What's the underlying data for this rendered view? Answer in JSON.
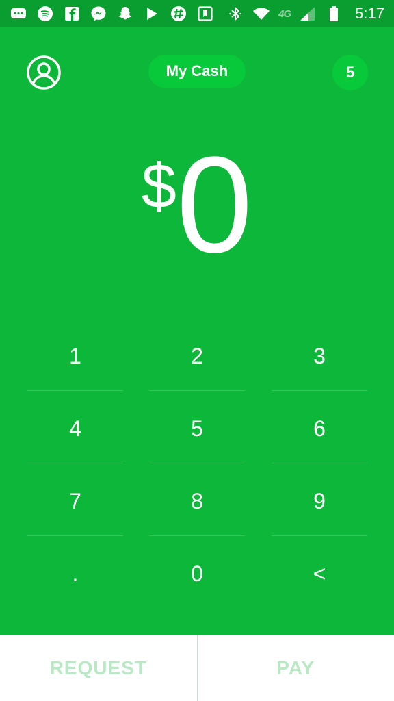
{
  "status_bar": {
    "icons_left": [
      "message-icon",
      "spotify-icon",
      "facebook-icon",
      "messenger-icon",
      "snapchat-icon",
      "play-store-icon",
      "slack-icon",
      "bookmark-icon"
    ],
    "icons_right": [
      "bluetooth-icon",
      "wifi-icon",
      "signal-icon",
      "battery-icon"
    ],
    "network": "4G",
    "time": "5:17"
  },
  "header": {
    "profile_icon": "person-circle-icon",
    "title_button": "My Cash",
    "badge_count": "5"
  },
  "amount": {
    "currency_symbol": "$",
    "value": "0"
  },
  "keypad": {
    "keys": [
      "1",
      "2",
      "3",
      "4",
      "5",
      "6",
      "7",
      "8",
      "9",
      ".",
      "0",
      "<"
    ]
  },
  "actions": {
    "request_label": "REQUEST",
    "pay_label": "PAY"
  },
  "colors": {
    "background": "#0db73a",
    "status_bar": "#0a9e31",
    "pill": "#07c93a",
    "action_text": "#b8e8c4"
  }
}
